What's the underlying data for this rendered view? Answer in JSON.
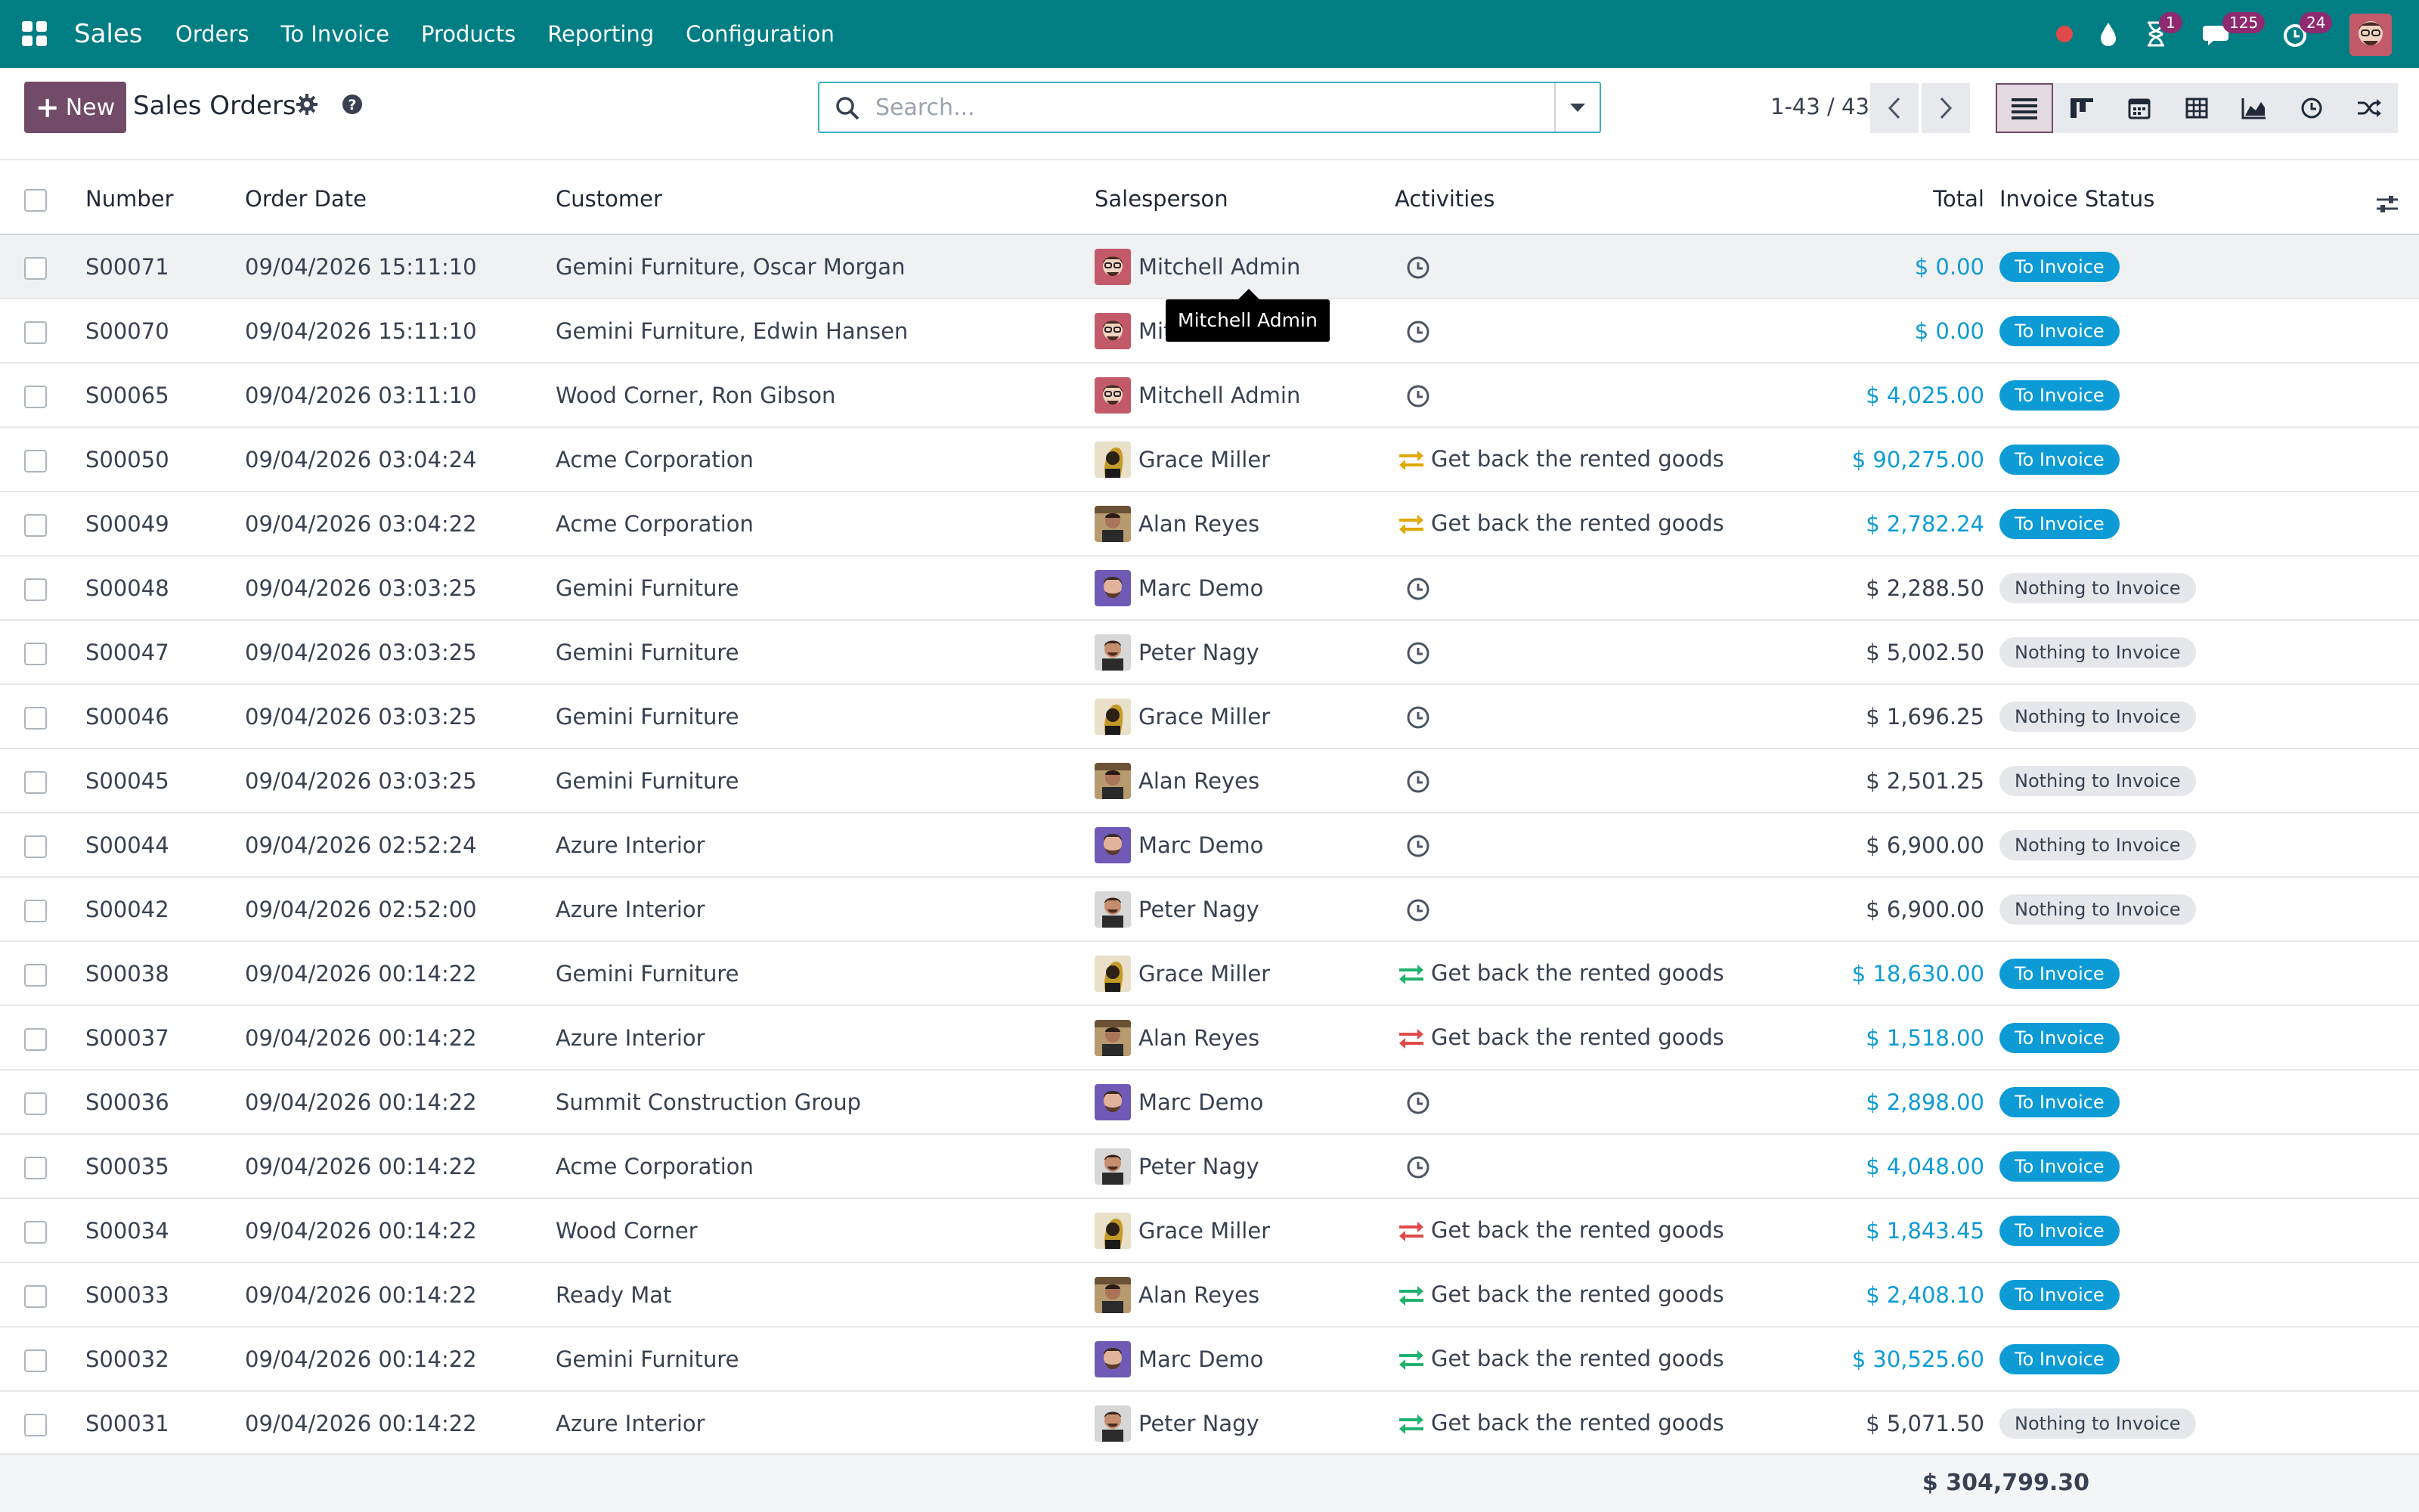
{
  "navbar": {
    "app_name": "Sales",
    "menu": [
      "Orders",
      "To Invoice",
      "Products",
      "Reporting",
      "Configuration"
    ],
    "activity_badge": "1",
    "messages_badge": "125",
    "timer_badge": "24",
    "color": "#017e84"
  },
  "control": {
    "new_label": "New",
    "title": "Sales Orders",
    "search_placeholder": "Search...",
    "pager": "1-43 / 43"
  },
  "table": {
    "headers": {
      "number": "Number",
      "order_date": "Order Date",
      "customer": "Customer",
      "salesperson": "Salesperson",
      "activities": "Activities",
      "total": "Total",
      "invoice_status": "Invoice Status"
    },
    "rows": [
      {
        "number": "S00071",
        "date": "09/04/2026 15:11:10",
        "customer": "Gemini Furniture, Oscar Morgan",
        "salesperson": "Mitchell Admin",
        "activity": "",
        "total": "$ 0.00",
        "status": "To Invoice"
      },
      {
        "number": "S00070",
        "date": "09/04/2026 15:11:10",
        "customer": "Gemini Furniture, Edwin Hansen",
        "salesperson": "Mitchell Admin",
        "activity": "",
        "total": "$ 0.00",
        "status": "To Invoice"
      },
      {
        "number": "S00065",
        "date": "09/04/2026 03:11:10",
        "customer": "Wood Corner, Ron Gibson",
        "salesperson": "Mitchell Admin",
        "activity": "",
        "total": "$ 4,025.00",
        "status": "To Invoice"
      },
      {
        "number": "S00050",
        "date": "09/04/2026 03:04:24",
        "customer": "Acme Corporation",
        "salesperson": "Grace Miller",
        "activity": "Get back the rented goods",
        "total": "$ 90,275.00",
        "status": "To Invoice"
      },
      {
        "number": "S00049",
        "date": "09/04/2026 03:04:22",
        "customer": "Acme Corporation",
        "salesperson": "Alan Reyes",
        "activity": "Get back the rented goods",
        "total": "$ 2,782.24",
        "status": "To Invoice"
      },
      {
        "number": "S00048",
        "date": "09/04/2026 03:03:25",
        "customer": "Gemini Furniture",
        "salesperson": "Marc Demo",
        "activity": "",
        "total": "$ 2,288.50",
        "status": "Nothing to Invoice"
      },
      {
        "number": "S00047",
        "date": "09/04/2026 03:03:25",
        "customer": "Gemini Furniture",
        "salesperson": "Peter Nagy",
        "activity": "",
        "total": "$ 5,002.50",
        "status": "Nothing to Invoice"
      },
      {
        "number": "S00046",
        "date": "09/04/2026 03:03:25",
        "customer": "Gemini Furniture",
        "salesperson": "Grace Miller",
        "activity": "",
        "total": "$ 1,696.25",
        "status": "Nothing to Invoice"
      },
      {
        "number": "S00045",
        "date": "09/04/2026 03:03:25",
        "customer": "Gemini Furniture",
        "salesperson": "Alan Reyes",
        "activity": "",
        "total": "$ 2,501.25",
        "status": "Nothing to Invoice"
      },
      {
        "number": "S00044",
        "date": "09/04/2026 02:52:24",
        "customer": "Azure Interior",
        "salesperson": "Marc Demo",
        "activity": "",
        "total": "$ 6,900.00",
        "status": "Nothing to Invoice"
      },
      {
        "number": "S00042",
        "date": "09/04/2026 02:52:00",
        "customer": "Azure Interior",
        "salesperson": "Peter Nagy",
        "activity": "",
        "total": "$ 6,900.00",
        "status": "Nothing to Invoice"
      },
      {
        "number": "S00038",
        "date": "09/04/2026 00:14:22",
        "customer": "Gemini Furniture",
        "salesperson": "Grace Miller",
        "activity": "Get back the rented goods",
        "total": "$ 18,630.00",
        "status": "To Invoice"
      },
      {
        "number": "S00037",
        "date": "09/04/2026 00:14:22",
        "customer": "Azure Interior",
        "salesperson": "Alan Reyes",
        "activity": "Get back the rented goods",
        "total": "$ 1,518.00",
        "status": "To Invoice"
      },
      {
        "number": "S00036",
        "date": "09/04/2026 00:14:22",
        "customer": "Summit Construction Group",
        "salesperson": "Marc Demo",
        "activity": "",
        "total": "$ 2,898.00",
        "status": "To Invoice"
      },
      {
        "number": "S00035",
        "date": "09/04/2026 00:14:22",
        "customer": "Acme Corporation",
        "salesperson": "Peter Nagy",
        "activity": "",
        "total": "$ 4,048.00",
        "status": "To Invoice"
      },
      {
        "number": "S00034",
        "date": "09/04/2026 00:14:22",
        "customer": "Wood Corner",
        "salesperson": "Grace Miller",
        "activity": "Get back the rented goods",
        "total": "$ 1,843.45",
        "status": "To Invoice"
      },
      {
        "number": "S00033",
        "date": "09/04/2026 00:14:22",
        "customer": "Ready Mat",
        "salesperson": "Alan Reyes",
        "activity": "Get back the rented goods",
        "total": "$ 2,408.10",
        "status": "To Invoice"
      },
      {
        "number": "S00032",
        "date": "09/04/2026 00:14:22",
        "customer": "Gemini Furniture",
        "salesperson": "Marc Demo",
        "activity": "Get back the rented goods",
        "total": "$ 30,525.60",
        "status": "To Invoice"
      },
      {
        "number": "S00031",
        "date": "09/04/2026 00:14:22",
        "customer": "Azure Interior",
        "salesperson": "Peter Nagy",
        "activity": "Get back the rented goods",
        "total": "$ 5,071.50",
        "status": "Nothing to Invoice"
      }
    ],
    "grand_total": "$ 304,799.30"
  },
  "tooltip": "Mitchell Admin",
  "colors": {
    "primary": "#714b67",
    "link": "#0d9bd6",
    "activity_warning": "#e0a800",
    "activity_ok": "#21b26f",
    "activity_overdue": "#e04a4a"
  }
}
